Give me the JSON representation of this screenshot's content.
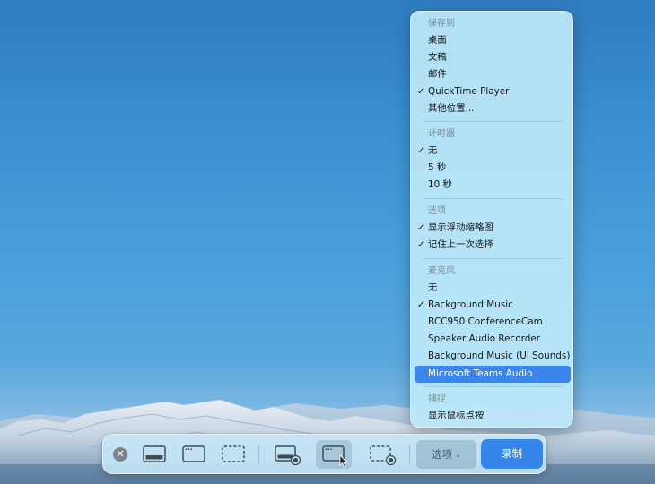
{
  "menu": {
    "save_header": "保存到",
    "save_desktop": "桌面",
    "save_documents": "文稿",
    "save_mail": "邮件",
    "save_quicktime": "QuickTime Player",
    "save_other": "其他位置...",
    "timer_header": "计时器",
    "timer_none": "无",
    "timer_5s": "5 秒",
    "timer_10s": "10 秒",
    "options_header": "选项",
    "opt_floating_thumb": "显示浮动缩略图",
    "opt_remember": "记住上一次选择",
    "mic_header": "麦克风",
    "mic_none": "无",
    "mic_bg_music": "Background Music",
    "mic_bcc950": "BCC950 ConferenceCam",
    "mic_speaker": "Speaker Audio Recorder",
    "mic_bg_ui": "Background Music (UI Sounds)",
    "mic_teams": "Microsoft Teams Audio",
    "capture_header": "捕捉",
    "cap_show_clicks": "显示鼠标点按",
    "checkmark": "✓"
  },
  "toolbar": {
    "close_glyph": "✕",
    "options_label": "选项",
    "options_chevron": "⌄",
    "record_label": "录制"
  },
  "icons": {
    "close": "close-icon",
    "capture_screen": "capture-entire-screen-icon",
    "capture_window": "capture-window-icon",
    "capture_selection": "capture-selection-icon",
    "record_screen": "record-entire-screen-icon",
    "record_window": "record-window-icon",
    "record_selection": "record-selection-icon"
  },
  "colors": {
    "accent": "#3686ea",
    "menu_highlight": "#3b86ea"
  }
}
